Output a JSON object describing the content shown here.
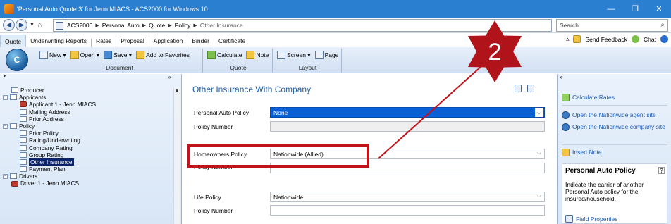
{
  "window": {
    "title": "'Personal Auto Quote 3' for Jenn MIACS - ACS2000 for Windows 10",
    "controls": [
      "—",
      "❐",
      "✕"
    ]
  },
  "nav": {
    "breadcrumbs": [
      "ACS2000",
      "Personal Auto",
      "Quote",
      "Policy",
      "Other Insurance"
    ],
    "search_placeholder": "Search"
  },
  "ribbon_tabs": [
    "Quote",
    "Underwriting Reports",
    "Rates",
    "Proposal",
    "Application",
    "Binder",
    "Certificate"
  ],
  "ribbon_right": {
    "send_feedback": "Send Feedback",
    "chat": "Chat"
  },
  "ribbon": {
    "logo": "C",
    "groups": [
      {
        "label": "Document",
        "items": [
          "New ▾",
          "Open ▾",
          "Save ▾",
          "Add to Favorites"
        ]
      },
      {
        "label": "Quote",
        "items": [
          "Calculate",
          "Note"
        ]
      },
      {
        "label": "Layout",
        "items": [
          "Screen ▾",
          "Page"
        ]
      }
    ]
  },
  "tree": [
    {
      "label": "Producer",
      "level": 1,
      "type": "doc"
    },
    {
      "label": "Applicants",
      "level": 0,
      "type": "folder"
    },
    {
      "label": "Applicant 1 - Jenn MIACS",
      "level": 2,
      "type": "person"
    },
    {
      "label": "Mailing Address",
      "level": 2,
      "type": "doc"
    },
    {
      "label": "Prior Address",
      "level": 2,
      "type": "doc"
    },
    {
      "label": "Policy",
      "level": 0,
      "type": "folder"
    },
    {
      "label": "Prior Policy",
      "level": 2,
      "type": "doc"
    },
    {
      "label": "Rating/Underwriting",
      "level": 2,
      "type": "doc"
    },
    {
      "label": "Company Rating",
      "level": 2,
      "type": "doc"
    },
    {
      "label": "Group Rating",
      "level": 2,
      "type": "doc"
    },
    {
      "label": "Other Insurance",
      "level": 2,
      "type": "doc",
      "selected": true
    },
    {
      "label": "Payment Plan",
      "level": 2,
      "type": "doc"
    },
    {
      "label": "Drivers",
      "level": 0,
      "type": "folder"
    },
    {
      "label": "Driver 1 - Jenn MIACS",
      "level": 1,
      "type": "person"
    }
  ],
  "form": {
    "title": "Other Insurance With Company",
    "personal_auto_label": "Personal Auto Policy",
    "personal_auto_value": "None",
    "policy_number_label": "Policy Number",
    "homeowners_label": "Homeowners Policy",
    "homeowners_value": "Nationwide (Allied)",
    "homeowners_policy_number_label": "Policy Number",
    "life_label": "Life Policy",
    "life_value": "Nationwide",
    "life_policy_number_label": "Policy Number"
  },
  "right_panel": {
    "calculate_rates": "Calculate Rates",
    "nw_agent_site": "Open the Nationwide agent site",
    "nw_company_site": "Open the Nationwide company site",
    "insert_note": "Insert Note",
    "help_title": "Personal Auto Policy",
    "help_text": "Indicate the carrier of another Personal Auto policy for the insured/household.",
    "field_properties": "Field Properties"
  },
  "annotation": {
    "step_number": "2",
    "highlight_color": "#c0141a",
    "star_color": "#b0141a"
  }
}
